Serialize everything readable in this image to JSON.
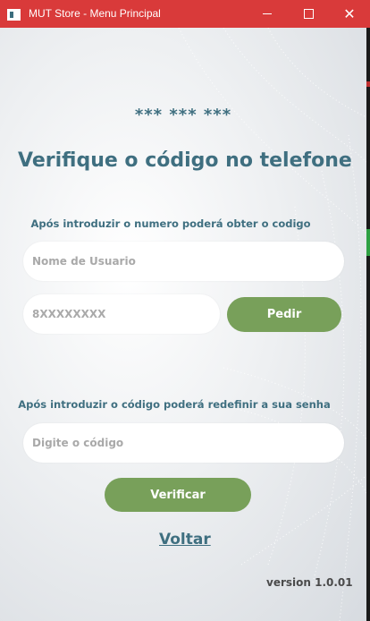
{
  "window": {
    "title": "MUT Store - Menu Principal",
    "close_glyph": "✕"
  },
  "page": {
    "masked_phone": "*** *** ***",
    "heading": "Verifique o código no telefone",
    "hint_phone": "Após introduzir o numero poderá obter o codigo",
    "username_placeholder": "Nome de Usuario",
    "phone_placeholder": "8XXXXXXXX",
    "request_button": "Pedir",
    "hint_code": "Após introduzir o código poderá redefinir a sua senha",
    "code_placeholder": "Digite o código",
    "verify_button": "Verificar",
    "back_link": "Voltar",
    "version": "version 1.0.01"
  },
  "colors": {
    "titlebar": "#d93a3a",
    "accent_text": "#3f6f80",
    "button": "#78a05a"
  }
}
